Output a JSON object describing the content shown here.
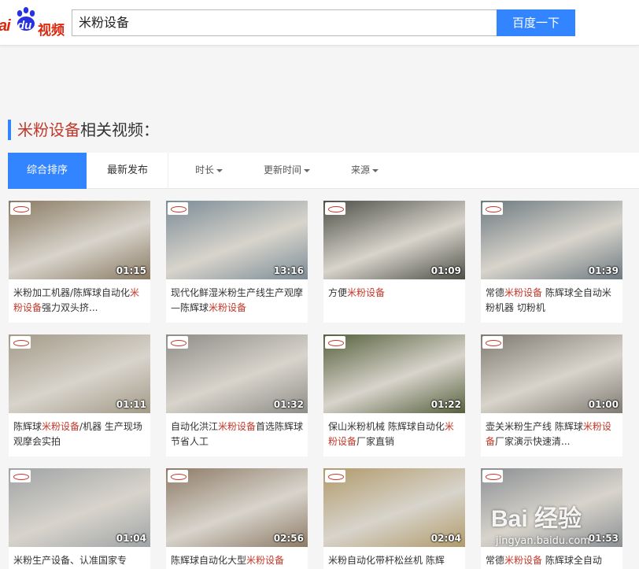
{
  "header": {
    "logo_text_bai": "ai",
    "logo_text_du": "du",
    "logo_text_video": "视频",
    "search_value": "米粉设备",
    "search_button": "百度一下"
  },
  "section": {
    "title_highlight": "米粉设备",
    "title_rest": "相关视频："
  },
  "filters": {
    "tabs": [
      "综合排序",
      "最新发布"
    ],
    "dropdowns": [
      "时长",
      "更新时间",
      "来源"
    ]
  },
  "videos": [
    {
      "duration": "01:15",
      "title_a": "米粉加工机器/陈辉球自动化",
      "title_hl": "米粉设备",
      "title_b": "强力双头挤...",
      "thumb_color": "#8a7a63"
    },
    {
      "duration": "13:16",
      "title_a": "现代化鲜湿米粉生产线生产观摩—陈辉球",
      "title_hl": "米粉设备",
      "title_b": "",
      "thumb_color": "#7b8c96"
    },
    {
      "duration": "01:09",
      "title_a": "方便",
      "title_hl": "米粉设备",
      "title_b": "",
      "thumb_color": "#4d4f46"
    },
    {
      "duration": "01:39",
      "title_a": "常德",
      "title_hl": "米粉设备",
      "title_b": " 陈辉球全自动米粉机器 切粉机",
      "thumb_color": "#6d7a80"
    },
    {
      "duration": "01:11",
      "title_a": "陈辉球",
      "title_hl": "米粉设备",
      "title_b": "/机器 生产现场观摩会实拍",
      "thumb_color": "#a39a88"
    },
    {
      "duration": "01:32",
      "title_a": "自动化洪江",
      "title_hl": "米粉设备",
      "title_b": "首选陈辉球节省人工",
      "thumb_color": "#8d8c86"
    },
    {
      "duration": "01:22",
      "title_a": "保山米粉机械 陈辉球自动化",
      "title_hl": "米粉设备",
      "title_b": "厂家直销",
      "thumb_color": "#55603c"
    },
    {
      "duration": "01:00",
      "title_a": "壶关米粉生产线 陈辉球",
      "title_hl": "米粉设备",
      "title_b": "厂家演示快速清...",
      "thumb_color": "#7e7a72"
    },
    {
      "duration": "01:04",
      "title_a": "米粉生产设备、认准国家专",
      "title_hl": "",
      "title_b": "",
      "thumb_color": "#9fa3a5"
    },
    {
      "duration": "02:56",
      "title_a": "陈辉球自动化大型",
      "title_hl": "米粉设备",
      "title_b": "",
      "thumb_color": "#8d7a66"
    },
    {
      "duration": "02:04",
      "title_a": "米粉自动化带杆松丝机 陈辉",
      "title_hl": "",
      "title_b": "",
      "thumb_color": "#b09a6a"
    },
    {
      "duration": "01:53",
      "title_a": "常德",
      "title_hl": "米粉设备",
      "title_b": " 陈辉球全自动",
      "thumb_color": "#8b8f93"
    }
  ],
  "watermark": {
    "main": "Bai 经验",
    "sub": "jingyan.baidu.com"
  },
  "colors": {
    "accent": "#3385ff",
    "highlight": "#c0392b"
  }
}
